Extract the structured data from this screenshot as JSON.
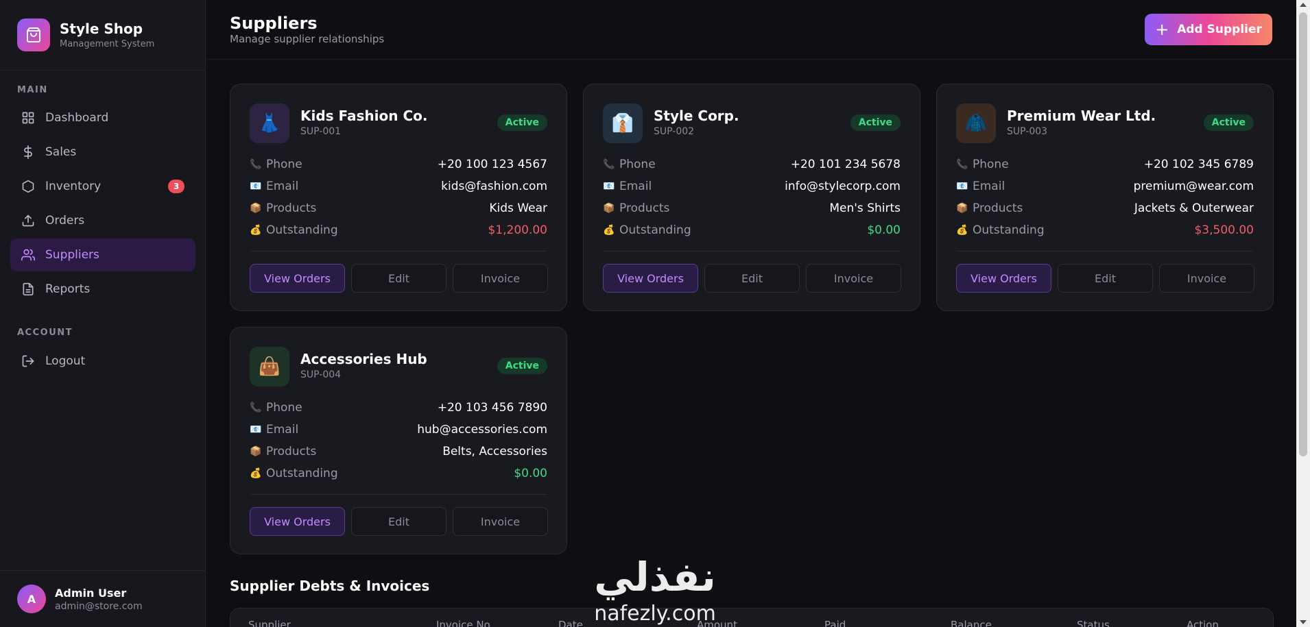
{
  "brand": {
    "title": "Style Shop",
    "subtitle": "Management System"
  },
  "sidebar": {
    "main_label": "MAIN",
    "items": [
      {
        "label": "Dashboard",
        "icon": "grid-icon"
      },
      {
        "label": "Sales",
        "icon": "dollar-icon"
      },
      {
        "label": "Inventory",
        "icon": "box-icon",
        "badge": "3"
      },
      {
        "label": "Orders",
        "icon": "upload-icon"
      },
      {
        "label": "Suppliers",
        "icon": "users-icon",
        "active": true
      },
      {
        "label": "Reports",
        "icon": "file-icon"
      }
    ],
    "account_label": "ACCOUNT",
    "logout_label": "Logout"
  },
  "user": {
    "initial": "A",
    "name": "Admin User",
    "email": "admin@store.com"
  },
  "header": {
    "title": "Suppliers",
    "subtitle": "Manage supplier relationships",
    "add_button": "Add Supplier"
  },
  "labels": {
    "phone": "Phone",
    "email": "Email",
    "products": "Products",
    "outstanding": "Outstanding",
    "view_orders": "View Orders",
    "edit": "Edit",
    "invoice": "Invoice"
  },
  "suppliers": [
    {
      "name": "Kids Fashion Co.",
      "code": "SUP-001",
      "status": "Active",
      "phone": "+20 100 123 4567",
      "email": "kids@fashion.com",
      "products": "Kids Wear",
      "outstanding": "$1,200.00",
      "emoji": "👗",
      "icon_bg": "#2c2440"
    },
    {
      "name": "Style Corp.",
      "code": "SUP-002",
      "status": "Active",
      "phone": "+20 101 234 5678",
      "email": "info@stylecorp.com",
      "products": "Men's Shirts",
      "outstanding": "$0.00",
      "emoji": "👔",
      "icon_bg": "#22303f"
    },
    {
      "name": "Premium Wear Ltd.",
      "code": "SUP-003",
      "status": "Active",
      "phone": "+20 102 345 6789",
      "email": "premium@wear.com",
      "products": "Jackets & Outerwear",
      "outstanding": "$3,500.00",
      "emoji": "🧥",
      "icon_bg": "#3a2a22"
    },
    {
      "name": "Accessories Hub",
      "code": "SUP-004",
      "status": "Active",
      "phone": "+20 103 456 7890",
      "email": "hub@accessories.com",
      "products": "Belts, Accessories",
      "outstanding": "$0.00",
      "emoji": "👜",
      "icon_bg": "#1e3328"
    }
  ],
  "debts": {
    "title": "Supplier Debts & Invoices",
    "columns": [
      "Supplier",
      "Invoice No",
      "Date",
      "Amount",
      "Paid",
      "Balance",
      "Status",
      "Action"
    ]
  },
  "watermark": {
    "arabic": "نفذلي",
    "latin": "nafezly.com"
  },
  "colors": {
    "accent": "#8b5cf6",
    "accent2": "#ec4899",
    "danger": "#f25c6a",
    "success": "#3ddc84"
  }
}
